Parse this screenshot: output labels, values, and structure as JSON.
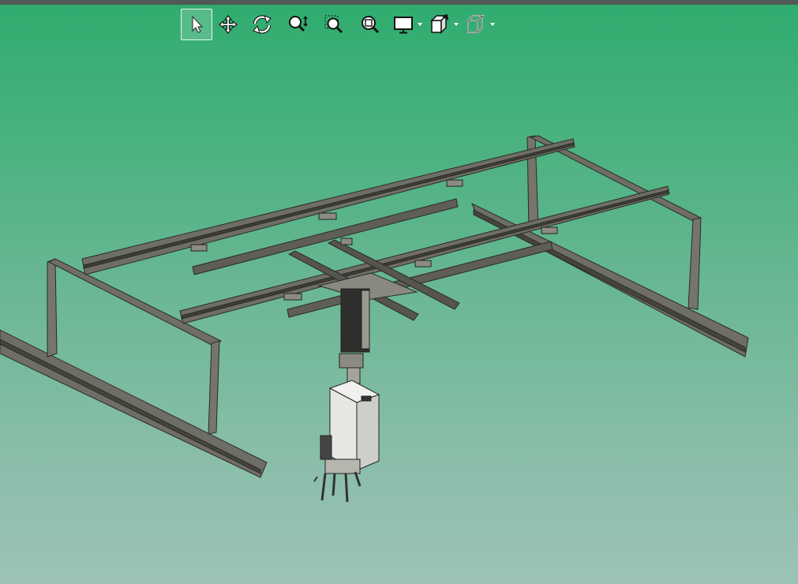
{
  "toolbar": {
    "buttons": [
      {
        "id": "select",
        "icon": "cursor-arrow-icon",
        "active": true
      },
      {
        "id": "pan",
        "icon": "move-arrows-icon"
      },
      {
        "id": "rotate",
        "icon": "rotate-icon"
      },
      {
        "id": "zoom",
        "icon": "zoom-icon"
      },
      {
        "id": "zoom-area",
        "icon": "zoom-area-icon"
      },
      {
        "id": "zoom-fit",
        "icon": "zoom-fit-icon"
      },
      {
        "id": "display",
        "icon": "monitor-icon",
        "dropdown": true
      },
      {
        "id": "view-orientation",
        "icon": "view-cube-icon",
        "dropdown": true
      },
      {
        "id": "display-style",
        "icon": "wireframe-cube-icon",
        "dropdown": true
      }
    ]
  },
  "colors": {
    "background_top": "#2fac6e",
    "background_bottom": "#9dc2b7",
    "steel": "#6f6e66",
    "steel_dark": "#3e3d38",
    "toolbar_bar": "#4f5a55"
  }
}
